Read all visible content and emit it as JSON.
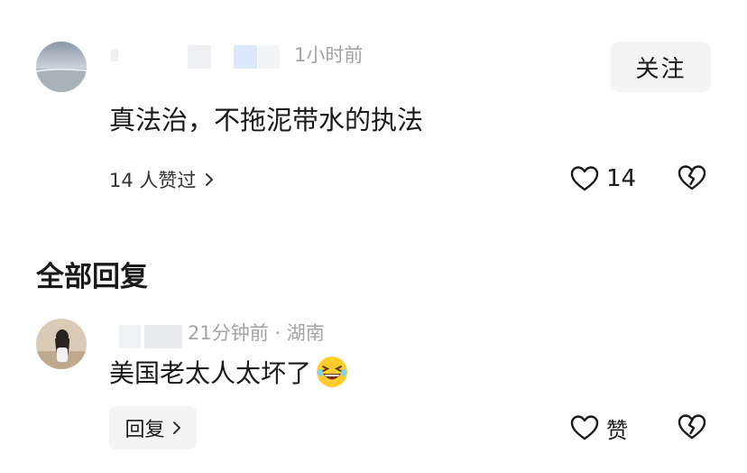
{
  "main_comment": {
    "time": "1小时前",
    "follow_label": "关注",
    "text": "真法治，不拖泥带水的执法",
    "likes_summary": "14 人赞过",
    "like_count": "14"
  },
  "replies_section": {
    "heading": "全部回复"
  },
  "reply": {
    "meta": "21分钟前 · 湖南",
    "text": "美国老太人太坏了",
    "emoji": "laughing-emoji",
    "reply_label": "回复",
    "like_label": "赞"
  },
  "icons": {
    "heart": "heart-icon",
    "broken_heart": "broken-heart-icon",
    "chevron": "chevron-right-icon"
  }
}
